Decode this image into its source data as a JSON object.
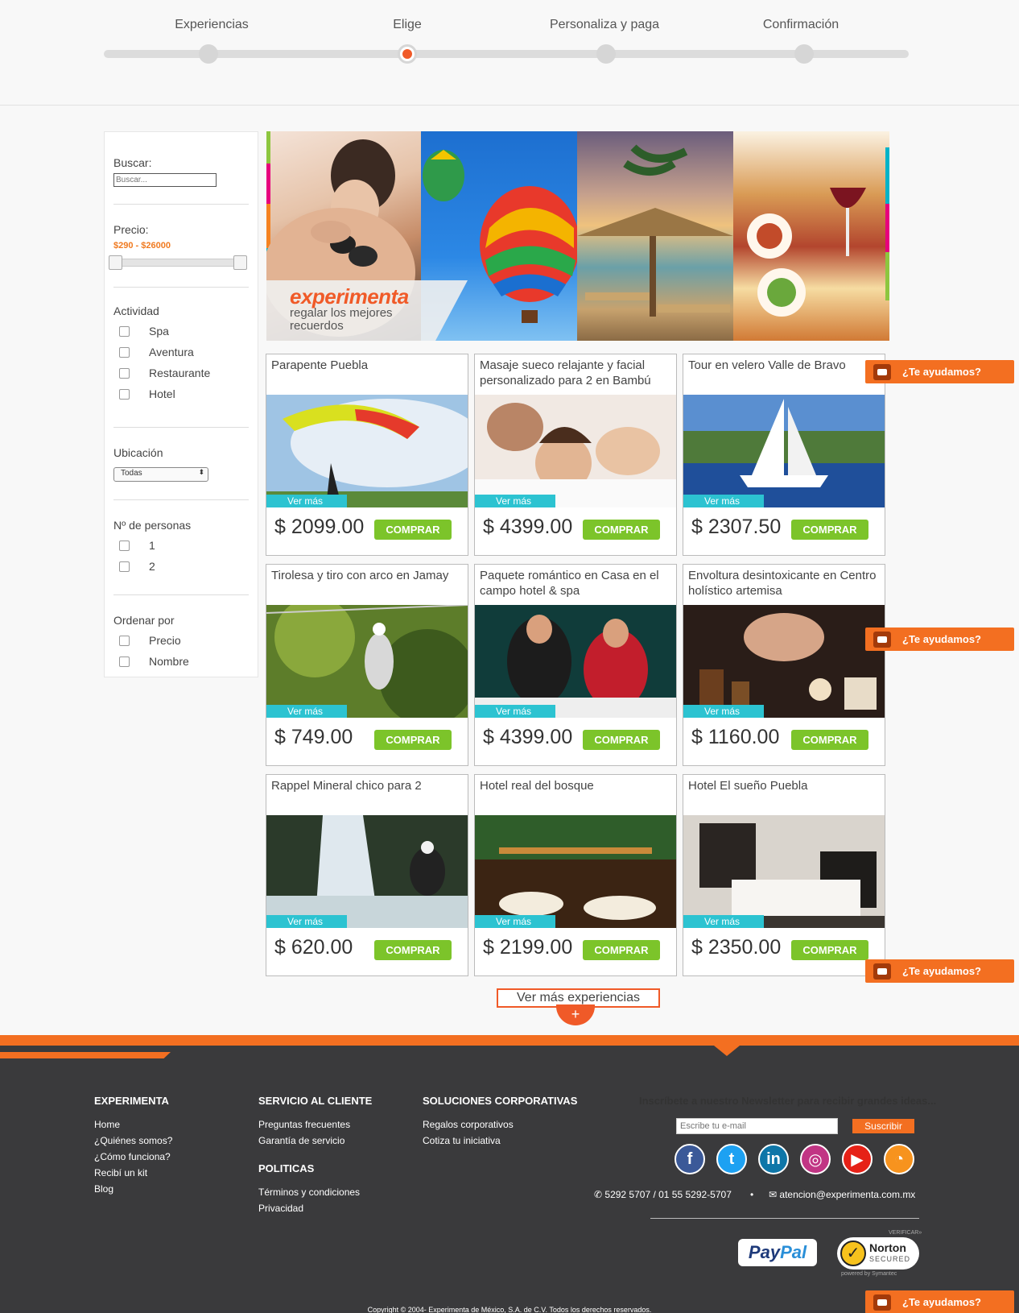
{
  "stepper": {
    "steps": [
      {
        "label": "Experiencias",
        "active": false
      },
      {
        "label": "Elige",
        "active": true
      },
      {
        "label": "Personaliza y paga",
        "active": false
      },
      {
        "label": "Confirmación",
        "active": false
      }
    ],
    "accent_color": "#f05a28"
  },
  "sidebar": {
    "search": {
      "label": "Buscar:",
      "placeholder": "Buscar..."
    },
    "price": {
      "label": "Precio:",
      "range_text": "$290 - $26000",
      "min": 290,
      "max": 26000
    },
    "activity": {
      "label": "Actividad",
      "options": [
        "Spa",
        "Aventura",
        "Restaurante",
        "Hotel"
      ]
    },
    "location": {
      "label": "Ubicación",
      "selected": "Todas"
    },
    "people": {
      "label": "Nº de personas",
      "options": [
        "1",
        "2"
      ]
    },
    "sort": {
      "label": "Ordenar por",
      "options": [
        "Precio",
        "Nombre"
      ]
    }
  },
  "banner": {
    "brand": "experimenta",
    "tagline": "regalar los mejores recuerdos"
  },
  "products": [
    {
      "title": "Parapente Puebla",
      "price": "$ 2099.00",
      "image": "paragliding-photo"
    },
    {
      "title": "Masaje sueco relajante y facial personalizado para 2 en Bambú",
      "price": "$ 4399.00",
      "image": "couple-massage-photo"
    },
    {
      "title": "Tour en velero Valle de Bravo",
      "price": "$ 2307.50",
      "image": "sailboat-photo"
    },
    {
      "title": "Tirolesa y tiro con arco en Jamay",
      "price": "$ 749.00",
      "image": "zipline-photo"
    },
    {
      "title": "Paquete romántico en Casa en el campo hotel & spa",
      "price": "$ 4399.00",
      "image": "romantic-dinner-photo"
    },
    {
      "title": "Envoltura desintoxicante en Centro holístico artemisa",
      "price": "$ 1160.00",
      "image": "spa-treatment-photo"
    },
    {
      "title": "Rappel Mineral chico para 2",
      "price": "$ 620.00",
      "image": "rappel-waterfall-photo"
    },
    {
      "title": "Hotel real del bosque",
      "price": "$ 2199.00",
      "image": "hotel-restaurant-photo"
    },
    {
      "title": "Hotel El sueño Puebla",
      "price": "$ 2350.00",
      "image": "hotel-bedroom-photo"
    }
  ],
  "card_labels": {
    "ver_mas": "Ver más",
    "comprar": "COMPRAR"
  },
  "load_more": {
    "label": "Ver más experiencias",
    "plus": "+"
  },
  "help_tab": {
    "label": "¿Te ayudamos?"
  },
  "footer": {
    "col1": {
      "title": "EXPERIMENTA",
      "links": [
        "Home",
        "¿Quiénes somos?",
        "¿Cómo funciona?",
        "Recibí un kit",
        "Blog"
      ]
    },
    "col2": {
      "title": "SERVICIO AL CLIENTE",
      "links": [
        "Preguntas frecuentes",
        "Garantía de servicio"
      ]
    },
    "col2b": {
      "title": "POLITICAS",
      "links": [
        "Términos y condiciones",
        "Privacidad"
      ]
    },
    "col3": {
      "title": "SOLUCIONES CORPORATIVAS",
      "links": [
        "Regalos corporativos",
        "Cotiza tu iniciativa"
      ]
    },
    "newsletter": {
      "title": "Inscríbete a nuestro Newsletter para recibir grandes ideas...",
      "placeholder": "Escribe tu e-mail",
      "button": "Suscribir"
    },
    "social": [
      {
        "name": "facebook-icon",
        "glyph": "f",
        "color": "#3b5998"
      },
      {
        "name": "twitter-icon",
        "glyph": "t",
        "color": "#1da1f2"
      },
      {
        "name": "linkedin-icon",
        "glyph": "in",
        "color": "#0e76a8"
      },
      {
        "name": "instagram-icon",
        "glyph": "◎",
        "color": "#c13584"
      },
      {
        "name": "youtube-icon",
        "glyph": "▶",
        "color": "#e62117"
      },
      {
        "name": "rss-icon",
        "glyph": "◔",
        "color": "#f7931e"
      }
    ],
    "phone": "5292 5707 / 01 55 5292-5707",
    "email": "atencion@experimenta.com.mx",
    "paypal": {
      "part1": "Pay",
      "part2": "Pal"
    },
    "norton": {
      "brand": "Norton",
      "sub": "SECURED",
      "verify": "VERIFICAR»",
      "powered": "powered by Symantec"
    },
    "copyright": "Copyright © 2004- Experimenta de México, S.A. de C.V. Todos los derechos reservados."
  }
}
